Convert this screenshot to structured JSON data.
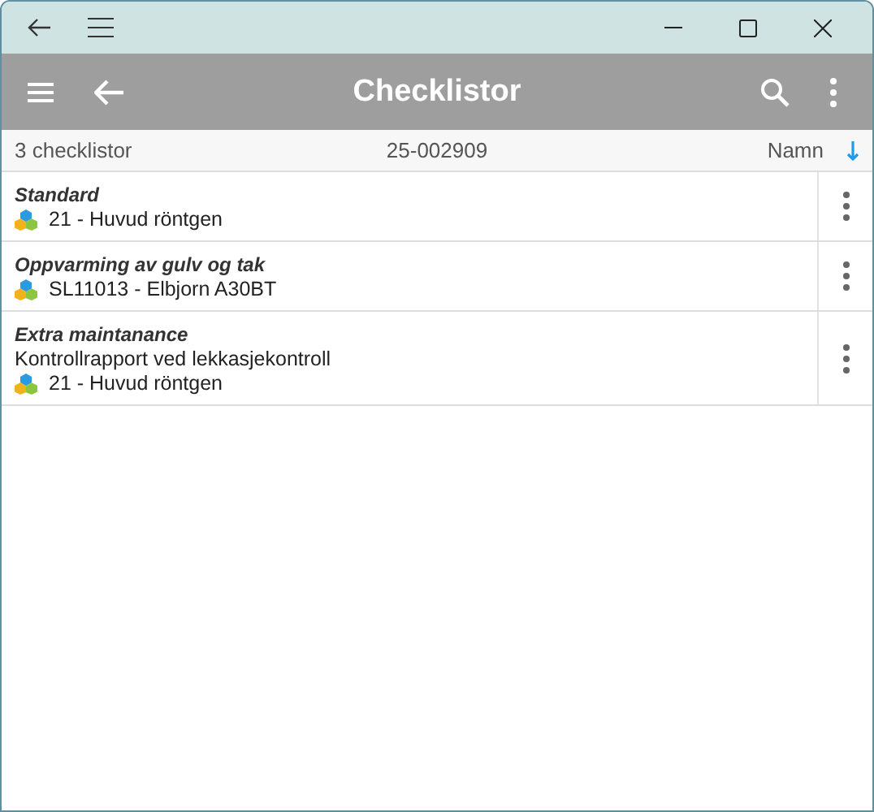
{
  "app_bar": {
    "title": "Checklistor"
  },
  "subheader": {
    "count": "3 checklistor",
    "order_number": "25-002909",
    "sort_label": "Namn"
  },
  "checklists": [
    {
      "title": "Standard",
      "object": "21 - Huvud röntgen"
    },
    {
      "title": "Oppvarming av gulv og tak",
      "object": "SL11013 - Elbjorn A30BT"
    },
    {
      "title": "Extra maintanance",
      "description": "Kontrollrapport ved lekkasjekontroll",
      "object": "21 - Huvud röntgen"
    }
  ]
}
